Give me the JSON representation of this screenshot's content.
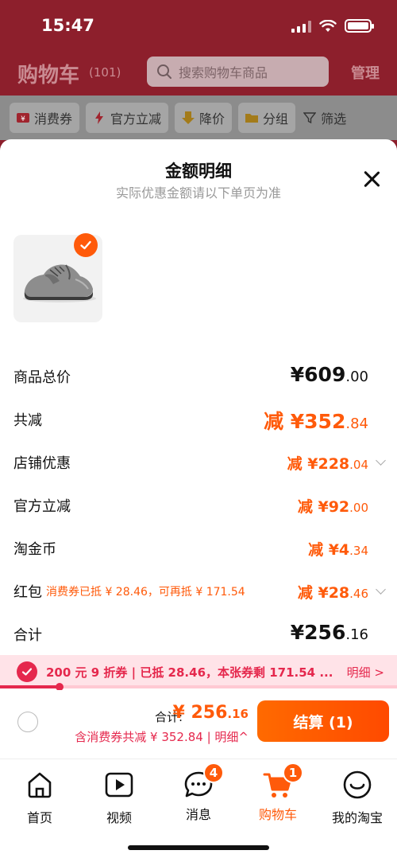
{
  "status": {
    "time": "15:47"
  },
  "header": {
    "title": "购物车",
    "count": "(101)",
    "search_placeholder": "搜索购物车商品",
    "manage": "管理"
  },
  "filters": [
    {
      "label": "消费券",
      "icon": "ticket-icon"
    },
    {
      "label": "官方立减",
      "icon": "lightning-icon"
    },
    {
      "label": "降价",
      "icon": "down-arrow-icon"
    },
    {
      "label": "分组",
      "icon": "folder-icon"
    },
    {
      "label": "筛选",
      "icon": "filter-icon"
    }
  ],
  "sheet": {
    "title": "金额明细",
    "subtitle": "实际优惠金额请以下单页为准",
    "product": {
      "image": "hiking-shoe-image",
      "selected": true
    }
  },
  "rows": {
    "total": {
      "label": "商品总价",
      "int": "¥609",
      "cents": ".00"
    },
    "discount": {
      "label": "共减",
      "int": "减 ¥352",
      "cents": ".84"
    },
    "store": {
      "label": "店铺优惠",
      "int": "减 ¥228",
      "cents": ".04"
    },
    "official": {
      "label": "官方立减",
      "int": "减 ¥92",
      "cents": ".00"
    },
    "coins": {
      "label": "淘金币",
      "int": "减 ¥4",
      "cents": ".34"
    },
    "redpacket": {
      "label": "红包",
      "sub": "消费券已抵 ¥ 28.46，可再抵 ¥ 171.54",
      "int": "减 ¥28",
      "cents": ".46"
    },
    "sum": {
      "label": "合计",
      "int": "¥256",
      "cents": ".16"
    }
  },
  "coupon_bar": {
    "text": "200 元 9 折券 | 已抵 28.46，本张券剩 171.54 ...",
    "detail": "明细 >",
    "progress": 0.15
  },
  "checkout": {
    "total_label": "合计:",
    "total_int": "¥ 256",
    "total_cents": ".16",
    "sub": "含消费券共减 ¥ 352.84 | 明细^",
    "button": "结算 (1)"
  },
  "tabs": [
    {
      "label": "首页",
      "icon": "home-icon"
    },
    {
      "label": "视频",
      "icon": "video-icon"
    },
    {
      "label": "消息",
      "icon": "message-icon",
      "badge": "4"
    },
    {
      "label": "购物车",
      "icon": "cart-icon",
      "badge": "1"
    },
    {
      "label": "我的淘宝",
      "icon": "smile-icon"
    }
  ],
  "colors": {
    "accent": "#ff5a0a",
    "coupon": "#e5284d"
  }
}
